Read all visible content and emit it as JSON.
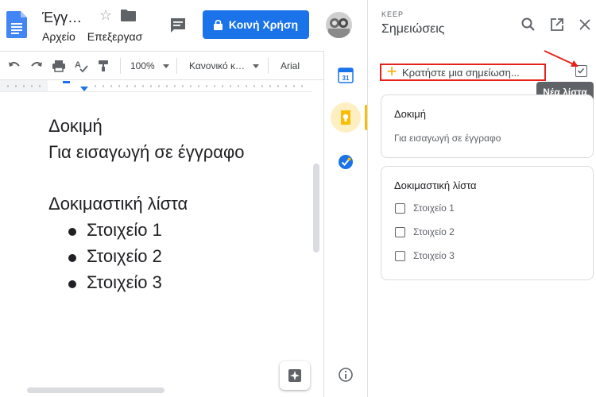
{
  "docs": {
    "title": "Έγγ…",
    "menu": [
      "Αρχείο",
      "Επεξεργασ"
    ],
    "share_label": "Κοινή Χρήση",
    "colors": {
      "share": "#1a73e8",
      "doc_blue": "#4285f4"
    }
  },
  "toolbar": {
    "zoom": "100%",
    "style": "Κανονικό κ…",
    "font": "Arial",
    "icons": [
      "undo-icon",
      "redo-icon",
      "print-icon",
      "spellcheck-icon",
      "paint-format-icon"
    ]
  },
  "document": {
    "lines": [
      "Δοκιμή",
      "Για εισαγωγή σε έγγραφο",
      "Δοκιμαστική λίστα"
    ],
    "bullets": [
      "Στοιχείο 1",
      "Στοιχείο 2",
      "Στοιχείο 3"
    ]
  },
  "side_rail": {
    "icons": [
      "calendar-icon",
      "keep-icon",
      "tasks-icon",
      "info-icon"
    ],
    "calendar_day": "31"
  },
  "keep": {
    "label": "KEEP",
    "title": "Σημειώσεις",
    "take_note_placeholder": "Κρατήστε μια σημείωση...",
    "new_list_tooltip": "Νέα λίστα",
    "notes": [
      {
        "title": "Δοκιμή",
        "body": "Για εισαγωγή σε έγγραφο"
      },
      {
        "title": "Δοκιμαστική λίστα",
        "items": [
          "Στοιχείο 1",
          "Στοιχείο 2",
          "Στοιχείο 3"
        ]
      }
    ],
    "colors": {
      "highlight": "#e8221b",
      "accent": "#fbbc04"
    }
  }
}
